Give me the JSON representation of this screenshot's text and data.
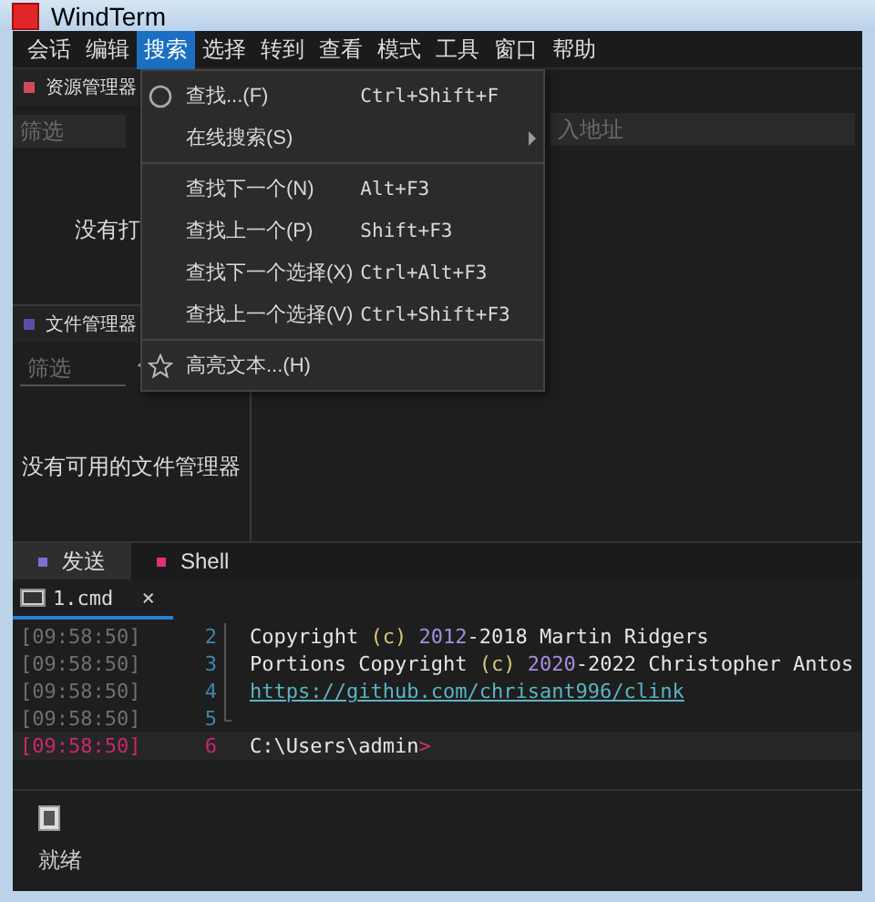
{
  "window": {
    "title": "WindTerm"
  },
  "menubar": [
    {
      "label": "会话",
      "selected": false
    },
    {
      "label": "编辑",
      "selected": false
    },
    {
      "label": "搜索",
      "selected": true
    },
    {
      "label": "选择",
      "selected": false
    },
    {
      "label": "转到",
      "selected": false
    },
    {
      "label": "查看",
      "selected": false
    },
    {
      "label": "模式",
      "selected": false
    },
    {
      "label": "工具",
      "selected": false
    },
    {
      "label": "窗口",
      "selected": false
    },
    {
      "label": "帮助",
      "selected": false
    }
  ],
  "search_menu": {
    "items": [
      {
        "kind": "search",
        "label": "查找...(F)",
        "shortcut": "Ctrl+Shift+F"
      },
      {
        "kind": "submenu",
        "label": "在线搜索(S)"
      },
      {
        "kind": "separator"
      },
      {
        "kind": "item",
        "label": "查找下一个(N)",
        "shortcut": "Alt+F3"
      },
      {
        "kind": "item",
        "label": "查找上一个(P)",
        "shortcut": "Shift+F3"
      },
      {
        "kind": "item",
        "label": "查找下一个选择(X)",
        "shortcut": "Ctrl+Alt+F3"
      },
      {
        "kind": "item",
        "label": "查找上一个选择(V)",
        "shortcut": "Ctrl+Shift+F3"
      },
      {
        "kind": "separator"
      },
      {
        "kind": "star",
        "label": "高亮文本...(H)"
      }
    ]
  },
  "resource_panel": {
    "title": "资源管理器",
    "filter": {
      "placeholder": "筛选"
    },
    "message": "没有打"
  },
  "address_field": {
    "placeholder": "入地址"
  },
  "file_panel": {
    "title": "文件管理器",
    "filter": {
      "placeholder": "筛选"
    },
    "message": "没有可用的文件管理器"
  },
  "bottom_tabs": [
    {
      "label": "发送",
      "selected": true,
      "color": "#7b6fd0"
    },
    {
      "label": "Shell",
      "selected": false,
      "color": "#e0307a"
    }
  ],
  "session_tab": {
    "label": "1.cmd",
    "close": "×"
  },
  "terminal": {
    "lines": [
      {
        "time": "[09:58:50]",
        "number": "2",
        "current": false,
        "segments": [
          {
            "kind": "text",
            "text": "Copyright "
          },
          {
            "kind": "paren",
            "text": "(c)"
          },
          {
            "kind": "number",
            "text": " 2012"
          },
          {
            "kind": "text",
            "text": "-2018 Martin Ridgers"
          }
        ]
      },
      {
        "time": "[09:58:50]",
        "number": "3",
        "current": false,
        "segments": [
          {
            "kind": "text",
            "text": "Portions Copyright "
          },
          {
            "kind": "paren",
            "text": "(c)"
          },
          {
            "kind": "number",
            "text": " 2020"
          },
          {
            "kind": "text",
            "text": "-2022 Christopher Antos"
          }
        ]
      },
      {
        "time": "[09:58:50]",
        "number": "4",
        "current": false,
        "segments": [
          {
            "kind": "url",
            "text": "https://github.com/chrisant996/clink"
          }
        ]
      },
      {
        "time": "[09:58:50]",
        "number": "5",
        "current": false
      },
      {
        "time": "[09:58:50]",
        "number": "6",
        "current": true,
        "segments": [
          {
            "kind": "text",
            "text": "C:\\Users\\admin"
          },
          {
            "kind": "prompt",
            "text": ">"
          }
        ]
      }
    ]
  },
  "status_bar": {
    "text": "就绪"
  }
}
